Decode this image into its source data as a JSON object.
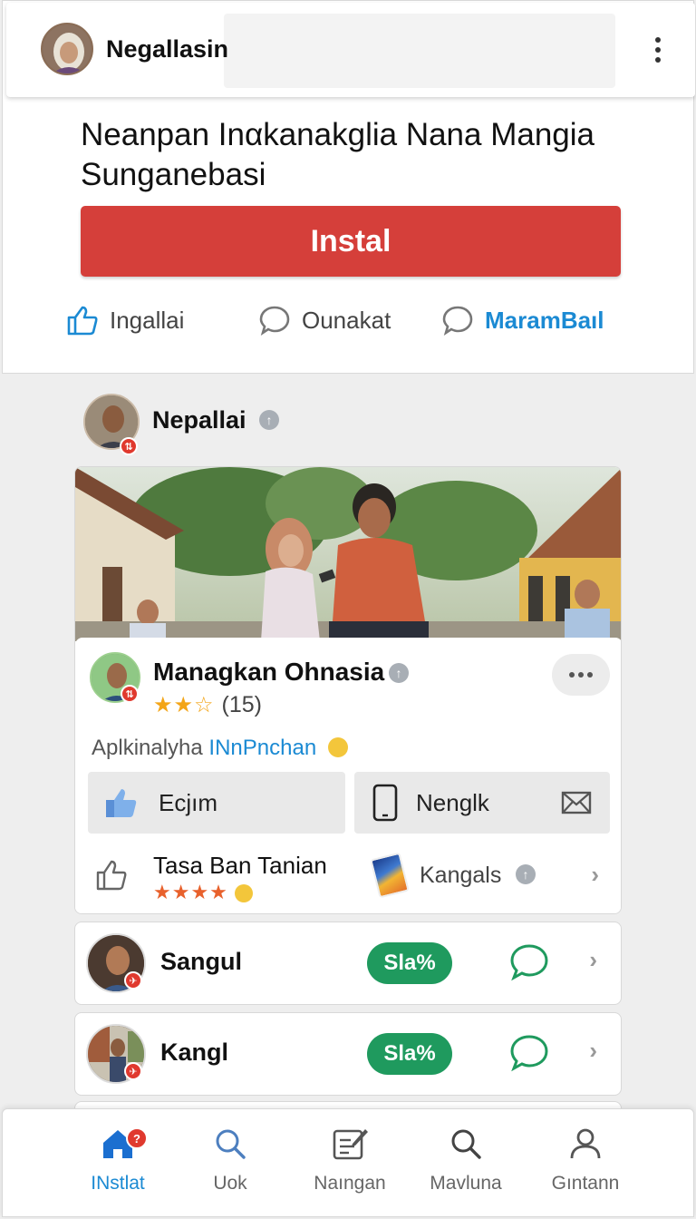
{
  "app_bar": {
    "title": "Negallasin",
    "avatar_icon": "user-avatar-hijab",
    "menu_icon": "kebab-menu-icon"
  },
  "hero": {
    "headline": "Neanpan Inαkanakglia Nana Mangia Sunganebasi",
    "install_label": "Instal",
    "install_color": "#d53f3a"
  },
  "actions": [
    {
      "label": "Ingallai",
      "icon": "thumbs-up-icon"
    },
    {
      "label": "Ounakat",
      "icon": "comment-icon"
    },
    {
      "label": "MaramBaıl",
      "icon": "comment-icon"
    }
  ],
  "poster": {
    "name": "Nepallai",
    "badge": "⇅"
  },
  "photo_card": {
    "name": "Managkan Ohnasia",
    "stars": "★★☆",
    "rating_count": "(15)",
    "subline_prefix": "Aplkinalyha",
    "subline_link": "INnPnchan",
    "tile_left_label": "Ecjım",
    "tile_right_label": "Nenglk",
    "row3_title": "Tasa Ban Tanian",
    "row3_stars": "★★★★",
    "row3_label": "Kangals",
    "badge": "⇅"
  },
  "list": [
    {
      "name": "Sangul",
      "pill": "Sla%"
    },
    {
      "name": "Kangl",
      "pill": "Sla%"
    }
  ],
  "bottom_nav": [
    {
      "label": "INstlat",
      "icon": "home-icon",
      "badge": "?"
    },
    {
      "label": "Uok",
      "icon": "search-icon"
    },
    {
      "label": "Naıngan",
      "icon": "edit-note-icon"
    },
    {
      "label": "Mavluna",
      "icon": "search-icon"
    },
    {
      "label": "Gıntann",
      "icon": "profile-icon"
    }
  ],
  "colors": {
    "accent_blue": "#1b8ad3",
    "pill_green": "#1f9a5e",
    "chat_green": "#1f9a5e",
    "badge_red": "#e0392e"
  }
}
